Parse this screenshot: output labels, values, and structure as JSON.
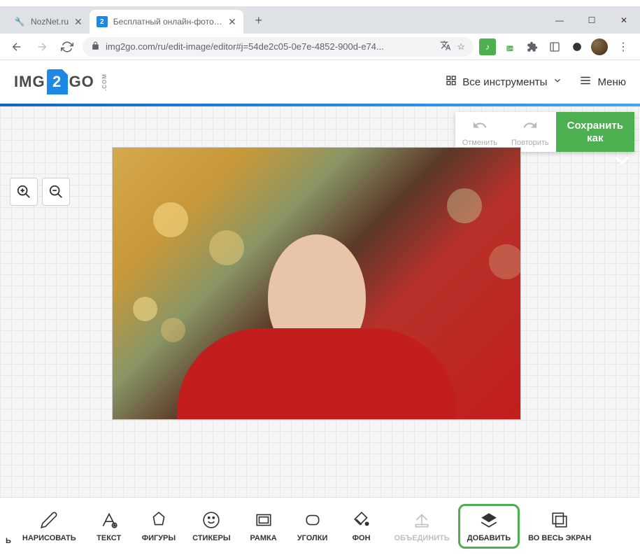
{
  "tabs": [
    {
      "title": "NozNet.ru",
      "active": false
    },
    {
      "title": "Бесплатный онлайн-фоторедак",
      "active": true
    }
  ],
  "address": {
    "url": "img2go.com/ru/edit-image/editor#j=54de2c05-0e7e-4852-900d-e74..."
  },
  "header": {
    "logo_pre": "IMG",
    "logo_mid": "2",
    "logo_post": "GO",
    "logo_suffix": ".COM",
    "tools_label": "Все инструменты",
    "menu_label": "Меню"
  },
  "editor_toolbar": {
    "undo": "Отменить",
    "redo": "Повторить",
    "save_line1": "Сохранить",
    "save_line2": "как"
  },
  "bottom_tools": {
    "partial": "Ь",
    "items": [
      {
        "label": "НАРИСОВАТЬ",
        "icon": "pencil"
      },
      {
        "label": "ТЕКСТ",
        "icon": "text"
      },
      {
        "label": "ФИГУРЫ",
        "icon": "shapes"
      },
      {
        "label": "СТИКЕРЫ",
        "icon": "smiley"
      },
      {
        "label": "РАМКА",
        "icon": "frame"
      },
      {
        "label": "УГОЛКИ",
        "icon": "corners"
      },
      {
        "label": "ФОН",
        "icon": "paint"
      },
      {
        "label": "ОБЪЕДИНИТЬ",
        "icon": "merge",
        "disabled": true
      },
      {
        "label": "ДОБАВИТЬ",
        "icon": "layers",
        "highlighted": true
      },
      {
        "label": "ВО ВЕСЬ ЭКРАН",
        "icon": "fullscreen"
      }
    ]
  }
}
